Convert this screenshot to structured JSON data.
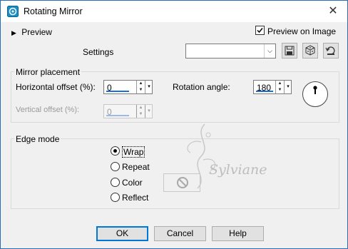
{
  "window": {
    "title": "Rotating Mirror"
  },
  "preview_row": {
    "preview_label": "Preview",
    "preview_on_image_label": "Preview on Image",
    "preview_on_image_checked": true
  },
  "settings": {
    "label": "Settings",
    "value": ""
  },
  "mirror": {
    "group_label": "Mirror placement",
    "horizontal_label": "Horizontal offset (%):",
    "horizontal_value": "0",
    "vertical_label": "Vertical offset (%):",
    "vertical_value": "0",
    "rotation_label": "Rotation angle:",
    "rotation_value": "180"
  },
  "edge": {
    "group_label": "Edge mode",
    "options": [
      "Wrap",
      "Repeat",
      "Color",
      "Reflect"
    ],
    "selected": "Wrap"
  },
  "watermark": {
    "text": "Sylviane"
  },
  "buttons": {
    "ok": "OK",
    "cancel": "Cancel",
    "help": "Help"
  },
  "colors": {
    "accent": "#1e6fd9",
    "title_icon": "#1a8fc7"
  }
}
